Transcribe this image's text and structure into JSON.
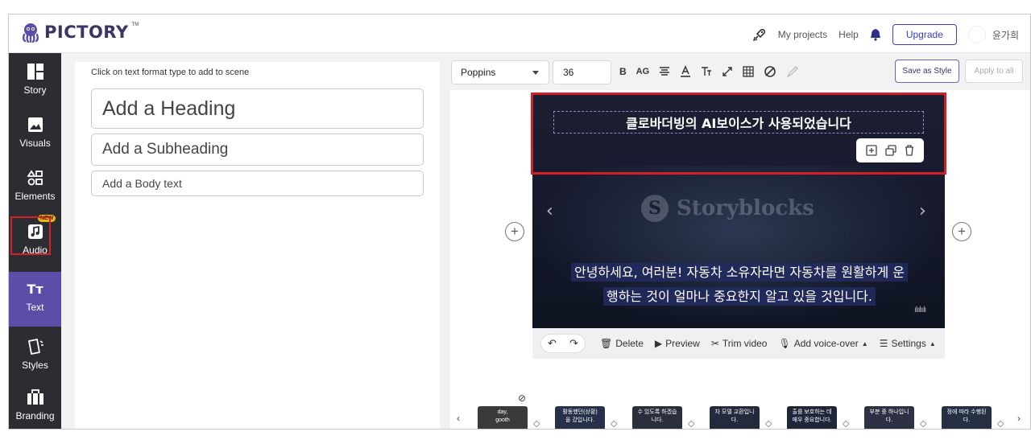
{
  "header": {
    "logo_text": "PICTORY",
    "logo_tm": "TM",
    "nav_links": [
      "My projects",
      "Help"
    ],
    "upgrade_label": "Upgrade",
    "username": "윤가희"
  },
  "sidebar": {
    "items": [
      {
        "label": "Story",
        "icon": "story-icon"
      },
      {
        "label": "Visuals",
        "icon": "image-icon"
      },
      {
        "label": "Elements",
        "icon": "elements-icon"
      },
      {
        "label": "Audio",
        "icon": "music-icon",
        "badge": "NEW"
      },
      {
        "label": "Text",
        "icon": "text-icon",
        "active": true
      },
      {
        "label": "Styles",
        "icon": "styles-icon"
      },
      {
        "label": "Branding",
        "icon": "briefcase-icon"
      }
    ]
  },
  "text_panel": {
    "hint": "Click on text format type to add to scene",
    "heading": "Add a Heading",
    "subheading": "Add a Subheading",
    "body": "Add a Body text"
  },
  "toolbar": {
    "font": "Poppins",
    "size": "36",
    "tools": [
      "B",
      "AG"
    ],
    "save_style": "Save as Style",
    "apply_all": "Apply to all"
  },
  "scene": {
    "heading_text": "클로바더빙의 AI보이스가 사용되었습니다",
    "watermark": "Storyblocks",
    "subtitle_line1": "안녕하세요, 여러분! 자동차 소유자라면 자동차를 원활하게 운",
    "subtitle_line2": "행하는 것이 얼마나 중요한지 알고 있을 것입니다."
  },
  "scene_bar": {
    "delete": "Delete",
    "preview": "Preview",
    "trim": "Trim video",
    "voice_over": "Add voice-over",
    "settings": "Settings"
  },
  "timeline": {
    "thumbs": [
      {
        "text": "day,\ngooth",
        "color": "#3a3a3a"
      },
      {
        "text": "활동했던(상황)\n을 갔입니다.",
        "color": "#27304a"
      },
      {
        "text": "수 있도록 하겠습\n니다.",
        "color": "#2a2f3e"
      },
      {
        "text": "차 모델 교환입니\n다.",
        "color": "#222a3c"
      },
      {
        "text": "출를 보호하는 데\n매우 중요합니다.",
        "color": "#1f2638"
      },
      {
        "text": "부분 중 하나입니\n다.",
        "color": "#2c3243"
      },
      {
        "text": "정에 따라 수행된\n다.",
        "color": "#253045"
      }
    ]
  },
  "colors": {
    "sidebar_bg": "#2c2c33",
    "active_bg": "#5b4ea8",
    "highlight_red": "#d32027",
    "upgrade_blue": "#3d3cc9"
  }
}
